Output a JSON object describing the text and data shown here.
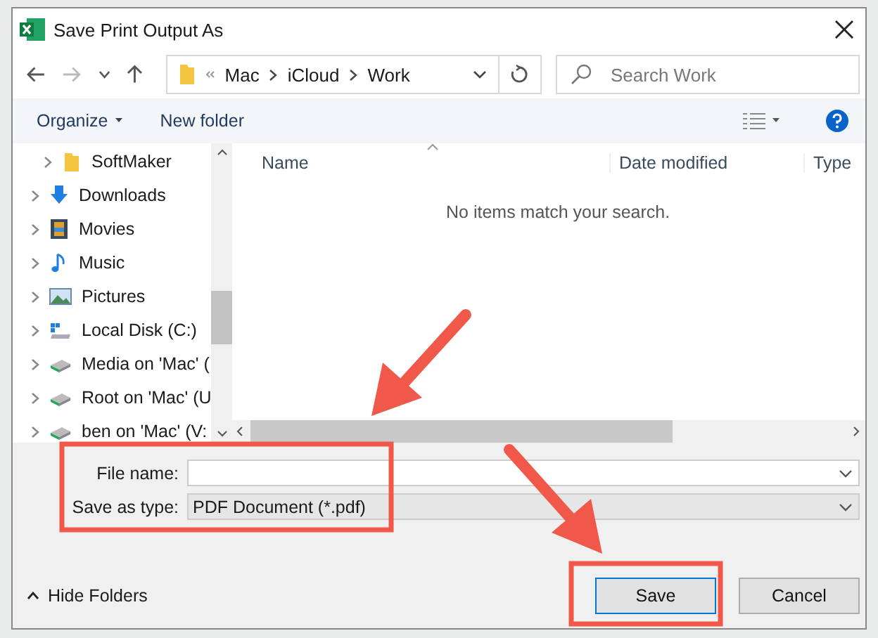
{
  "window": {
    "title": "Save Print Output As"
  },
  "address": {
    "path": [
      "Mac",
      "iCloud",
      "Work"
    ]
  },
  "search": {
    "placeholder": "Search Work"
  },
  "toolbar": {
    "organize": "Organize",
    "new_folder": "New folder"
  },
  "sidebar": {
    "items": [
      {
        "label": "SoftMaker",
        "kind": "folder",
        "expanded": false,
        "nested": true
      },
      {
        "label": "Downloads",
        "kind": "download",
        "expanded": false,
        "nested": false
      },
      {
        "label": "Movies",
        "kind": "film",
        "expanded": false,
        "nested": false
      },
      {
        "label": "Music",
        "kind": "note",
        "expanded": false,
        "nested": false
      },
      {
        "label": "Pictures",
        "kind": "picture",
        "expanded": false,
        "nested": false
      },
      {
        "label": "Local Disk (C:)",
        "kind": "disk",
        "expanded": false,
        "nested": false
      },
      {
        "label": "Media on 'Mac' (",
        "kind": "drive",
        "expanded": false,
        "nested": false
      },
      {
        "label": "Root on 'Mac' (U",
        "kind": "drive",
        "expanded": false,
        "nested": false
      },
      {
        "label": "ben on 'Mac' (V:",
        "kind": "drive",
        "expanded": false,
        "nested": false
      }
    ]
  },
  "table": {
    "columns": [
      "Name",
      "Date modified",
      "Type"
    ],
    "empty_message": "No items match your search."
  },
  "form": {
    "file_name": {
      "label": "File name:"
    },
    "save_type": {
      "label": "Save as type:",
      "value": "PDF Document (*.pdf)"
    }
  },
  "hide_folders": "Hide Folders",
  "buttons": [
    {
      "label": "Save",
      "default": true
    },
    {
      "label": "Cancel",
      "default": false
    }
  ]
}
